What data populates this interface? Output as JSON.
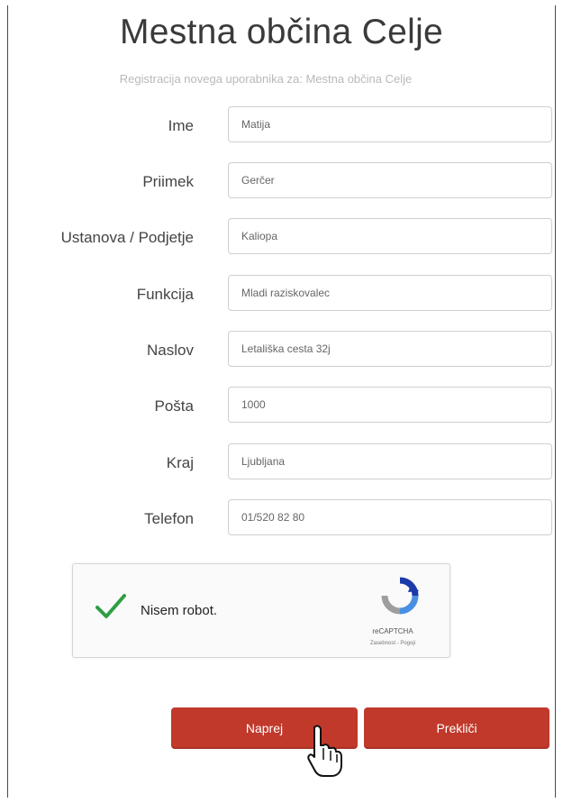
{
  "header": {
    "title": "Mestna občina Celje",
    "subtitle": "Registracija novega uporabnika za: Mestna občina Celje"
  },
  "form": {
    "fields": [
      {
        "label": "Ime",
        "value": "Matija"
      },
      {
        "label": "Priimek",
        "value": "Gerčer"
      },
      {
        "label": "Ustanova / Podjetje",
        "value": "Kaliopa"
      },
      {
        "label": "Funkcija",
        "value": "Mladi raziskovalec"
      },
      {
        "label": "Naslov",
        "value": "Letališka cesta 32j"
      },
      {
        "label": "Pošta",
        "value": "1000"
      },
      {
        "label": "Kraj",
        "value": "Ljubljana"
      },
      {
        "label": "Telefon",
        "value": "01/520 82 80"
      }
    ]
  },
  "captcha": {
    "checked": true,
    "label": "Nisem robot.",
    "brand": "reCAPTCHA",
    "links": "Zasebnost - Pogoji",
    "check_color": "#2e9e44"
  },
  "buttons": {
    "next_label": "Naprej",
    "cancel_label": "Prekliči",
    "accent": "#c0392b"
  }
}
